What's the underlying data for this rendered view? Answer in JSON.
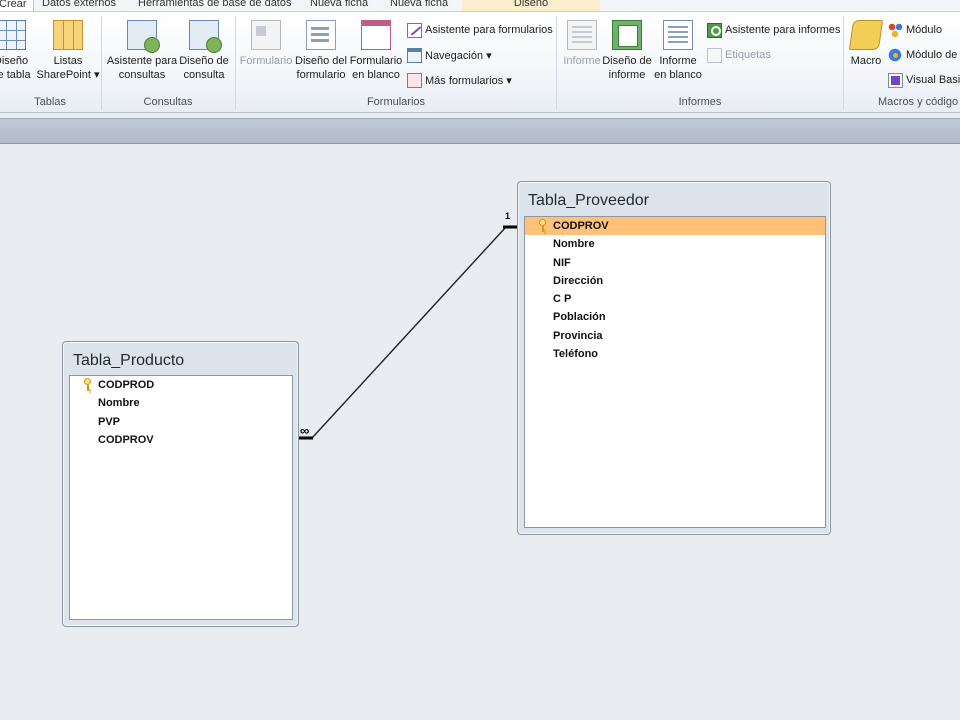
{
  "tabs": [
    {
      "label": "Crear"
    },
    {
      "label": "Datos externos"
    },
    {
      "label": "Herramientas de base de datos"
    },
    {
      "label": "Nueva ficha"
    },
    {
      "label": "Nueva ficha"
    },
    {
      "label": "Diseño"
    }
  ],
  "ribbon": {
    "tablas": {
      "label": "Tablas",
      "design": "Diseño\nde tabla",
      "sharepoint": "Listas\nSharePoint ▾"
    },
    "consultas": {
      "label": "Consultas",
      "wizard": "Asistente para\nconsultas",
      "design": "Diseño de\nconsulta"
    },
    "formularios": {
      "label": "Formularios",
      "form": "Formulario",
      "design": "Diseño del\nformulario",
      "blank": "Formulario\nen blanco",
      "wizard": "Asistente para formularios",
      "navigation": "Navegación ▾",
      "more": "Más formularios ▾"
    },
    "informes": {
      "label": "Informes",
      "report": "Informe",
      "design": "Diseño de\ninforme",
      "blank": "Informe\nen blanco",
      "wizard": "Asistente para informes",
      "labels": "Etiquetas"
    },
    "macros": {
      "label": "Macros y código",
      "macro": "Macro",
      "module": "Módulo",
      "class_module": "Módulo de clase",
      "vb": "Visual Basic"
    }
  },
  "tables": {
    "producto": {
      "title": "Tabla_Producto",
      "fields": [
        "CODPROD",
        "Nombre",
        "PVP",
        "CODPROV"
      ],
      "key_field": "CODPROD"
    },
    "proveedor": {
      "title": "Tabla_Proveedor",
      "fields": [
        "CODPROV",
        "Nombre",
        "NIF",
        "Dirección",
        "C P",
        "Población",
        "Provincia",
        "Teléfono"
      ],
      "key_field": "CODPROV",
      "selected_field": "CODPROV"
    }
  },
  "relationship": {
    "one_side_label": "1",
    "many_side_label": "∞"
  },
  "colors": {
    "selected_row": "#ffc07a",
    "canvas": "#e9ecf0",
    "doc_bar": "#b8c2cf"
  }
}
